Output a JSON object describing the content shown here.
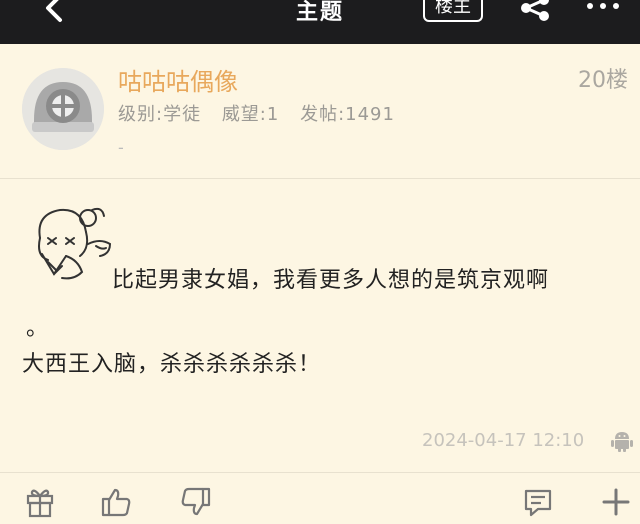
{
  "header": {
    "title": "主题",
    "op_badge": "楼主"
  },
  "post": {
    "username": "咕咕咕偶像",
    "floor": "20楼",
    "rank_label": "级别:学徒",
    "prestige_label": "威望:1",
    "posts_label": "发帖:1491",
    "signature": "-",
    "line1": "比起男隶女娼，我看更多人想的是筑京观啊",
    "line2": "。",
    "line3": "大西王入脑，杀杀杀杀杀杀！",
    "timestamp": "2024-04-17 12:10"
  },
  "colors": {
    "topbar": "#1c1c1e",
    "background": "#fdf6e3",
    "username": "#e8a85c",
    "muted": "#9c9a95",
    "icon": "#777777"
  },
  "icons": [
    "back-icon",
    "share-icon",
    "more-icon",
    "avatar-helmet-icon",
    "sticker-image",
    "android-icon",
    "gift-icon",
    "thumbs-up-icon",
    "thumbs-down-icon",
    "comment-icon",
    "plus-icon"
  ]
}
